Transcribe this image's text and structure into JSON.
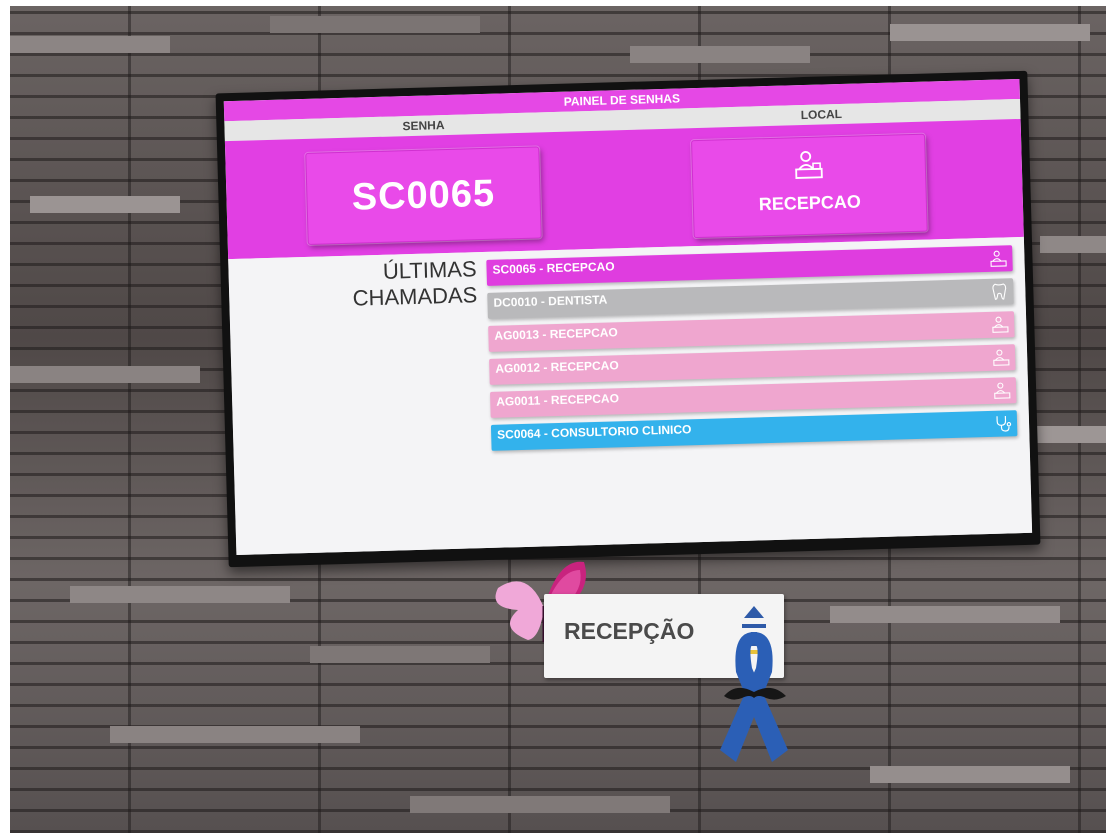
{
  "panel": {
    "title": "PAINEL DE SENHAS",
    "col_senha": "SENHA",
    "col_local": "LOCAL",
    "current_code": "SC0065",
    "current_sub": "",
    "current_local": "RECEPCAO",
    "current_local_icon": "reception-desk-icon",
    "recent_title_line1": "ÚLTIMAS",
    "recent_title_line2": "CHAMADAS",
    "recent": [
      {
        "label": "SC0065 - RECEPCAO",
        "color": "#df3ddf",
        "icon": "reception-desk-icon"
      },
      {
        "label": "DC0010 - DENTISTA",
        "color": "#b9b9bb",
        "icon": "tooth-icon"
      },
      {
        "label": "AG0013 - RECEPCAO",
        "color": "#efa6cf",
        "icon": "reception-desk-icon"
      },
      {
        "label": "AG0012 - RECEPCAO",
        "color": "#efa6cf",
        "icon": "reception-desk-icon"
      },
      {
        "label": "AG0011 - RECEPCAO",
        "color": "#efa6cf",
        "icon": "reception-desk-icon"
      },
      {
        "label": "SC0064 - CONSULTORIO CLINICO",
        "color": "#33b2ec",
        "icon": "stethoscope-icon"
      }
    ]
  },
  "sign": {
    "text": "RECEPÇÃO"
  },
  "colors": {
    "accent_magenta": "#e13fe3",
    "header_magenta": "#e548e5",
    "wall_gray": "#5a5250"
  }
}
